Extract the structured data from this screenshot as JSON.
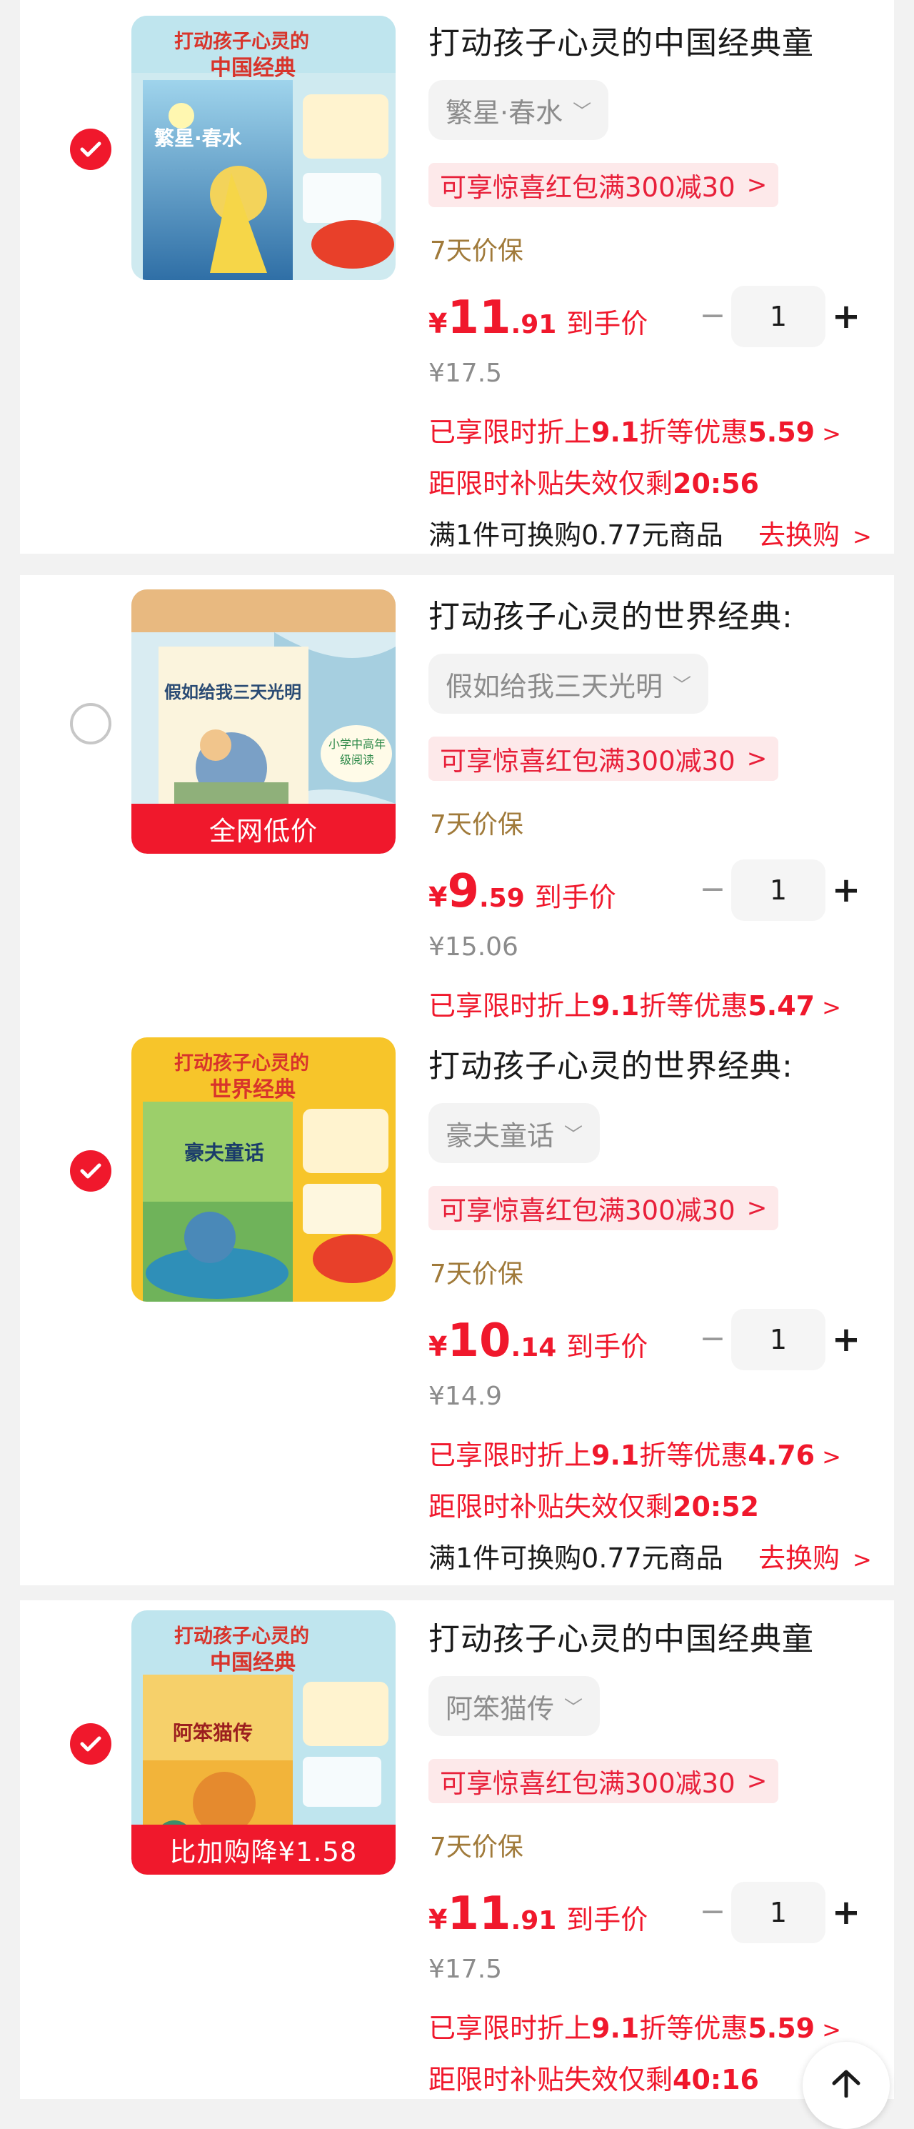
{
  "products": [
    {
      "checked": true,
      "title": "打动孩子心灵的中国经典童",
      "cover_lines": [
        "打动孩子心灵的",
        "中国经典",
        "繁星·春水"
      ],
      "badge": "",
      "variant": "繁星·春水",
      "coupon": "可享惊喜红包满300减30",
      "guarantee": "7天价保",
      "price_yen": "¥",
      "price_int": "11",
      "price_dec": ".91",
      "price_after": "到手价",
      "quantity": "1",
      "original_price": "¥17.5",
      "discount_prefix": "已享限时折上",
      "discount_rate": "9.1",
      "discount_mid": "折等优惠",
      "discount_amount": "5.59",
      "countdown_prefix": "距限时补贴失效仅剩",
      "countdown_time": "20:56",
      "exchange_text": "满1件可换购0.77元商品",
      "exchange_link": "去换购"
    },
    {
      "checked": false,
      "title": "打动孩子心灵的世界经典:",
      "cover_lines": [
        "假如给我三天光明",
        "小学中高年级阅读"
      ],
      "badge": "全网低价",
      "variant": "假如给我三天光明",
      "coupon": "可享惊喜红包满300减30",
      "guarantee": "7天价保",
      "price_yen": "¥",
      "price_int": "9",
      "price_dec": ".59",
      "price_after": "到手价",
      "quantity": "1",
      "original_price": "¥15.06",
      "discount_prefix": "已享限时折上",
      "discount_rate": "9.1",
      "discount_mid": "折等优惠",
      "discount_amount": "5.47",
      "countdown_prefix": "",
      "countdown_time": "",
      "exchange_text": "",
      "exchange_link": ""
    },
    {
      "checked": true,
      "title": "打动孩子心灵的世界经典:",
      "cover_lines": [
        "打动孩子心灵的",
        "世界经典",
        "豪夫童话"
      ],
      "badge": "",
      "variant": "豪夫童话",
      "coupon": "可享惊喜红包满300减30",
      "guarantee": "7天价保",
      "price_yen": "¥",
      "price_int": "10",
      "price_dec": ".14",
      "price_after": "到手价",
      "quantity": "1",
      "original_price": "¥14.9",
      "discount_prefix": "已享限时折上",
      "discount_rate": "9.1",
      "discount_mid": "折等优惠",
      "discount_amount": "4.76",
      "countdown_prefix": "距限时补贴失效仅剩",
      "countdown_time": "20:52",
      "exchange_text": "满1件可换购0.77元商品",
      "exchange_link": "去换购"
    },
    {
      "checked": true,
      "title": "打动孩子心灵的中国经典童",
      "cover_lines": [
        "打动孩子心灵的",
        "中国经典",
        "阿笨猫传"
      ],
      "badge": "比加购降¥1.58",
      "variant": "阿笨猫传",
      "coupon": "可享惊喜红包满300减30",
      "guarantee": "7天价保",
      "price_yen": "¥",
      "price_int": "11",
      "price_dec": ".91",
      "price_after": "到手价",
      "quantity": "1",
      "original_price": "¥17.5",
      "discount_prefix": "已享限时折上",
      "discount_rate": "9.1",
      "discount_mid": "折等优惠",
      "discount_amount": "5.59",
      "countdown_prefix": "距限时补贴失效仅剩",
      "countdown_time": "40:16",
      "exchange_text": "",
      "exchange_link": ""
    }
  ],
  "icons": {
    "check": "checkmark-icon",
    "chevron": "chevron-down-icon",
    "arrow": "chevron-right-icon",
    "top": "back-to-top-icon"
  },
  "colors": {
    "accent_red": "#f0182c",
    "coupon_bg": "#fde9ea",
    "guarantee_gold": "#a07a3a"
  }
}
